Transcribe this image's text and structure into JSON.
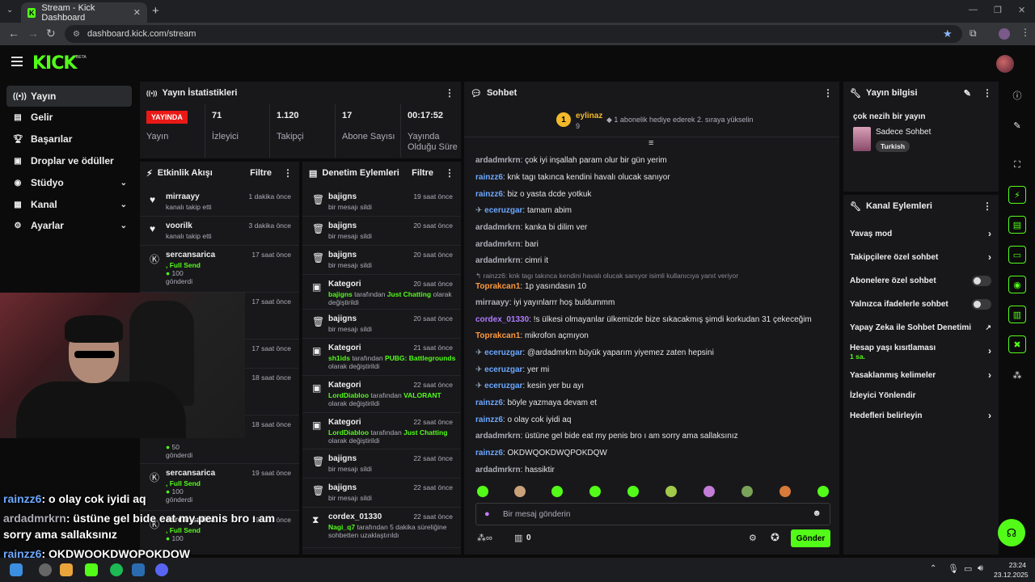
{
  "browser": {
    "tab_title": "Stream - Kick Dashboard",
    "url": "dashboard.kick.com/stream"
  },
  "app": {
    "logo": "KICK",
    "logo_badge": "BETA"
  },
  "sidebar": {
    "items": [
      {
        "label": "Yayın",
        "icon": "broadcast-icon"
      },
      {
        "label": "Gelir",
        "icon": "revenue-icon"
      },
      {
        "label": "Başarılar",
        "icon": "trophy-icon"
      },
      {
        "label": "Droplar ve ödüller",
        "icon": "gift-icon"
      },
      {
        "label": "Stüdyo",
        "icon": "studio-icon"
      },
      {
        "label": "Kanal",
        "icon": "channel-icon"
      },
      {
        "label": "Ayarlar",
        "icon": "gear-icon"
      }
    ]
  },
  "stats": {
    "title": "Yayın İstatistikleri",
    "live_badge": "YAYINDA",
    "live_label": "Yayın",
    "viewers": {
      "value": "71",
      "label": "İzleyici"
    },
    "followers": {
      "value": "1.120",
      "label": "Takipçi"
    },
    "subs": {
      "value": "17",
      "label": "Abone Sayısı"
    },
    "uptime": {
      "value": "00:17:52",
      "label1": "Yayında",
      "label2": "Olduğu Süre"
    }
  },
  "activity": {
    "title": "Etkinlik Akışı",
    "filter": "Filtre",
    "rows": [
      {
        "name": "mirraayy",
        "sub": "kanalı takip etti",
        "time": "1 dakika önce"
      },
      {
        "name": "voorilk",
        "sub": "kanalı takip etti",
        "time": "3 dakika önce"
      },
      {
        "name": "sercansarica",
        "sub1": ", Full Send",
        "sub2": "100",
        "sub3": "gönderdi",
        "time": "17 saat önce"
      },
      {
        "time": "17 saat önce"
      },
      {
        "time": "17 saat önce"
      },
      {
        "time": "18 saat önce"
      },
      {
        "time": "18 saat önce",
        "amount": "50",
        "sub3": "gönderdi"
      },
      {
        "name": "sercansarica",
        "sub1": ", Full Send",
        "sub2": "100",
        "sub3": "gönderdi",
        "time": "19 saat önce"
      },
      {
        "name": "sercansarica",
        "sub1": ", Full Send",
        "sub2": "100",
        "time": "19 saat önce"
      }
    ]
  },
  "moderation": {
    "title": "Denetim Eylemleri",
    "filter": "Filtre",
    "rows": [
      {
        "name": "bajigns",
        "sub": "bir mesajı sildi",
        "time": "19 saat önce",
        "icon": "trash-icon"
      },
      {
        "name": "bajigns",
        "sub": "bir mesajı sildi",
        "time": "20 saat önce",
        "icon": "trash-icon"
      },
      {
        "name": "bajigns",
        "sub": "bir mesajı sildi",
        "time": "20 saat önce",
        "icon": "trash-icon"
      },
      {
        "name": "Kategori",
        "actor": "bajigns",
        "mid": "tarafından",
        "game": "Just Chatting",
        "tail": "olarak",
        "tail2": "değiştirildi",
        "time": "20 saat önce",
        "icon": "category-icon"
      },
      {
        "name": "bajigns",
        "sub": "bir mesajı sildi",
        "time": "20 saat önce",
        "icon": "trash-icon"
      },
      {
        "name": "Kategori",
        "actor": "sh1ids",
        "mid": "tarafından",
        "game": "PUBG: Battlegrounds",
        "tail2": "olarak değiştirildi",
        "time": "21 saat önce",
        "icon": "category-icon"
      },
      {
        "name": "Kategori",
        "actor": "LordDiabloo",
        "mid": "tarafından",
        "game": "VALORANT",
        "tail2": "olarak değiştirildi",
        "time": "22 saat önce",
        "icon": "category-icon"
      },
      {
        "name": "Kategori",
        "actor": "LordDiabloo",
        "mid": "tarafından",
        "game": "Just Chatting",
        "tail2": "olarak değiştirildi",
        "time": "22 saat önce",
        "icon": "category-icon"
      },
      {
        "name": "bajigns",
        "sub": "bir mesajı sildi",
        "time": "22 saat önce",
        "icon": "trash-icon"
      },
      {
        "name": "bajigns",
        "sub": "bir mesajı sildi",
        "time": "22 saat önce",
        "icon": "trash-icon"
      },
      {
        "name": "cordex_01330",
        "actor": "Nagi_q7",
        "mid": "tarafından 5 dakika süreliğine",
        "tail2": "sohbetten uzaklaştırıldı",
        "time": "22 saat önce",
        "icon": "timeout-icon"
      }
    ]
  },
  "chat": {
    "title": "Sohbet",
    "pinned_rank": "1",
    "pinned_user": "eylinaz",
    "pinned_count": "9",
    "pinned_text": "1 abonelik hediye ederek 2. sıraya yükselin",
    "messages": [
      {
        "user": "ardadmrkrn",
        "color": "#adadb8",
        "text": "çok iyi inşallah param olur bir gün yerim"
      },
      {
        "user": "rainzz6",
        "color": "#6da8ff",
        "text": "knk tagı takınca kendini havalı olucak sanıyor"
      },
      {
        "user": "rainzz6",
        "color": "#6da8ff",
        "text": "biz o yasta dcde yotkuk"
      },
      {
        "user": "eceruzgar",
        "color": "#6da8ff",
        "text": "tamam abim",
        "badge": true
      },
      {
        "user": "ardadmrkrn",
        "color": "#adadb8",
        "text": "kanka bi dilim ver"
      },
      {
        "user": "ardadmrkrn",
        "color": "#adadb8",
        "text": "bari"
      },
      {
        "user": "ardadmrkrn",
        "color": "#adadb8",
        "text": "cimri it"
      },
      {
        "reply": "rainzz6: knk tagı takınca kendini havalı olucak sanıyor isimli kullanıcıya yanıt veriyor"
      },
      {
        "user": "Toprakcan1",
        "color": "#ff9a3c",
        "text": "1p yasındasın 10"
      },
      {
        "user": "mirraayy",
        "color": "#adadb8",
        "text": "iyi yayınlarrr hoş buldummm"
      },
      {
        "user": "cordex_01330",
        "color": "#b07cff",
        "text": "!s ülkesi olmayanlar ülkemizde bize sıkacakmış şimdi korkudan 31 çekeceğim"
      },
      {
        "user": "Toprakcan1",
        "color": "#ff9a3c",
        "text": "mikrofon açmıyon"
      },
      {
        "user": "eceruzgar",
        "color": "#6da8ff",
        "text": "@ardadmrkrn büyük yaparım yiyemez zaten hepsini",
        "badge": true
      },
      {
        "user": "eceruzgar",
        "color": "#6da8ff",
        "text": "yer mi",
        "badge": true
      },
      {
        "user": "eceruzgar",
        "color": "#6da8ff",
        "text": "kesin yer bu ayı",
        "badge": true
      },
      {
        "user": "rainzz6",
        "color": "#6da8ff",
        "text": "böyle yazmaya devam et"
      },
      {
        "user": "rainzz6",
        "color": "#6da8ff",
        "text": "o olay cok iyidi aq"
      },
      {
        "user": "ardadmrkrn",
        "color": "#adadb8",
        "text": "üstüne gel bide eat my penis bro ı am sorry ama sallaksınız"
      },
      {
        "user": "rainzz6",
        "color": "#6da8ff",
        "text": "OKDWQOKDWQPOKDQW"
      },
      {
        "user": "ardadmrkrn",
        "color": "#adadb8",
        "text": "hassiktir"
      }
    ],
    "input_placeholder": "Bir mesaj gönderin",
    "points": "0",
    "send": "Gönder"
  },
  "stream_info": {
    "title": "Yayın bilgisi",
    "stream_title": "çok nezih bir yayın",
    "category": "Sadece Sohbet",
    "language": "Turkish"
  },
  "channel_actions": {
    "title": "Kanal Eylemleri",
    "items": [
      {
        "label": "Yavaş mod",
        "type": "chevron"
      },
      {
        "label": "Takipçilere özel sohbet",
        "type": "chevron"
      },
      {
        "label": "Abonelere özel sohbet",
        "type": "toggle"
      },
      {
        "label": "Yalnızca ifadelerle sohbet",
        "type": "toggle"
      },
      {
        "label": "Yapay Zeka ile Sohbet Denetimi",
        "type": "external"
      },
      {
        "label": "Hesap yaşı kısıtlaması",
        "sub": "1 sa.",
        "type": "chevron"
      },
      {
        "label": "Yasaklanmış kelimeler",
        "type": "chevron"
      },
      {
        "label": "İzleyici Yönlendir",
        "type": "none"
      },
      {
        "label": "Hedefleri belirleyin",
        "type": "chevron"
      }
    ]
  },
  "overlay_chat": [
    {
      "user": "rainzz6",
      "color": "#6da8ff",
      "text": ": o olay cok iyidi aq"
    },
    {
      "user": "ardadmrkrn",
      "color": "#adadb8",
      "text": ": üstüne gel bide eat my penis bro ı am"
    },
    {
      "user": "",
      "color": "#ffffff",
      "text": "sorry ama sallaksınız"
    },
    {
      "user": "rainzz6",
      "color": "#6da8ff",
      "text": ": OKDWQOKDWQPOKDQW"
    },
    {
      "user": "ardadmrkrn",
      "color": "#adadb8",
      "text": " hassiktir"
    }
  ],
  "taskbar": {
    "time": "23:24",
    "date": "23.12.2025"
  },
  "colors": {
    "accent": "#53fc18",
    "live": "#e91916",
    "panel": "#18181b"
  }
}
